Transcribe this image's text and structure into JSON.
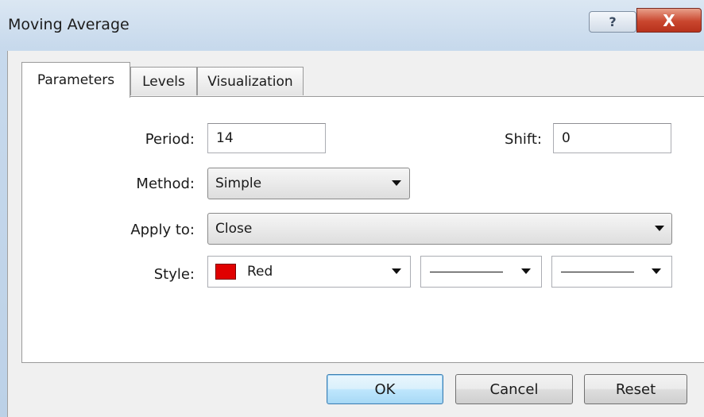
{
  "window": {
    "title": "Moving Average",
    "help_glyph": "?",
    "close_glyph": "X"
  },
  "tabs": [
    {
      "label": "Parameters",
      "active": true
    },
    {
      "label": "Levels",
      "active": false
    },
    {
      "label": "Visualization",
      "active": false
    }
  ],
  "parameters": {
    "period": {
      "label": "Period:",
      "value": "14"
    },
    "shift": {
      "label": "Shift:",
      "value": "0"
    },
    "method": {
      "label": "Method:",
      "value": "Simple"
    },
    "apply_to": {
      "label": "Apply to:",
      "value": "Close"
    },
    "style": {
      "label": "Style:",
      "color_name": "Red",
      "color_hex": "#e00000",
      "line_style": "solid",
      "line_width": "thin"
    }
  },
  "buttons": {
    "ok": "OK",
    "cancel": "Cancel",
    "reset": "Reset"
  }
}
